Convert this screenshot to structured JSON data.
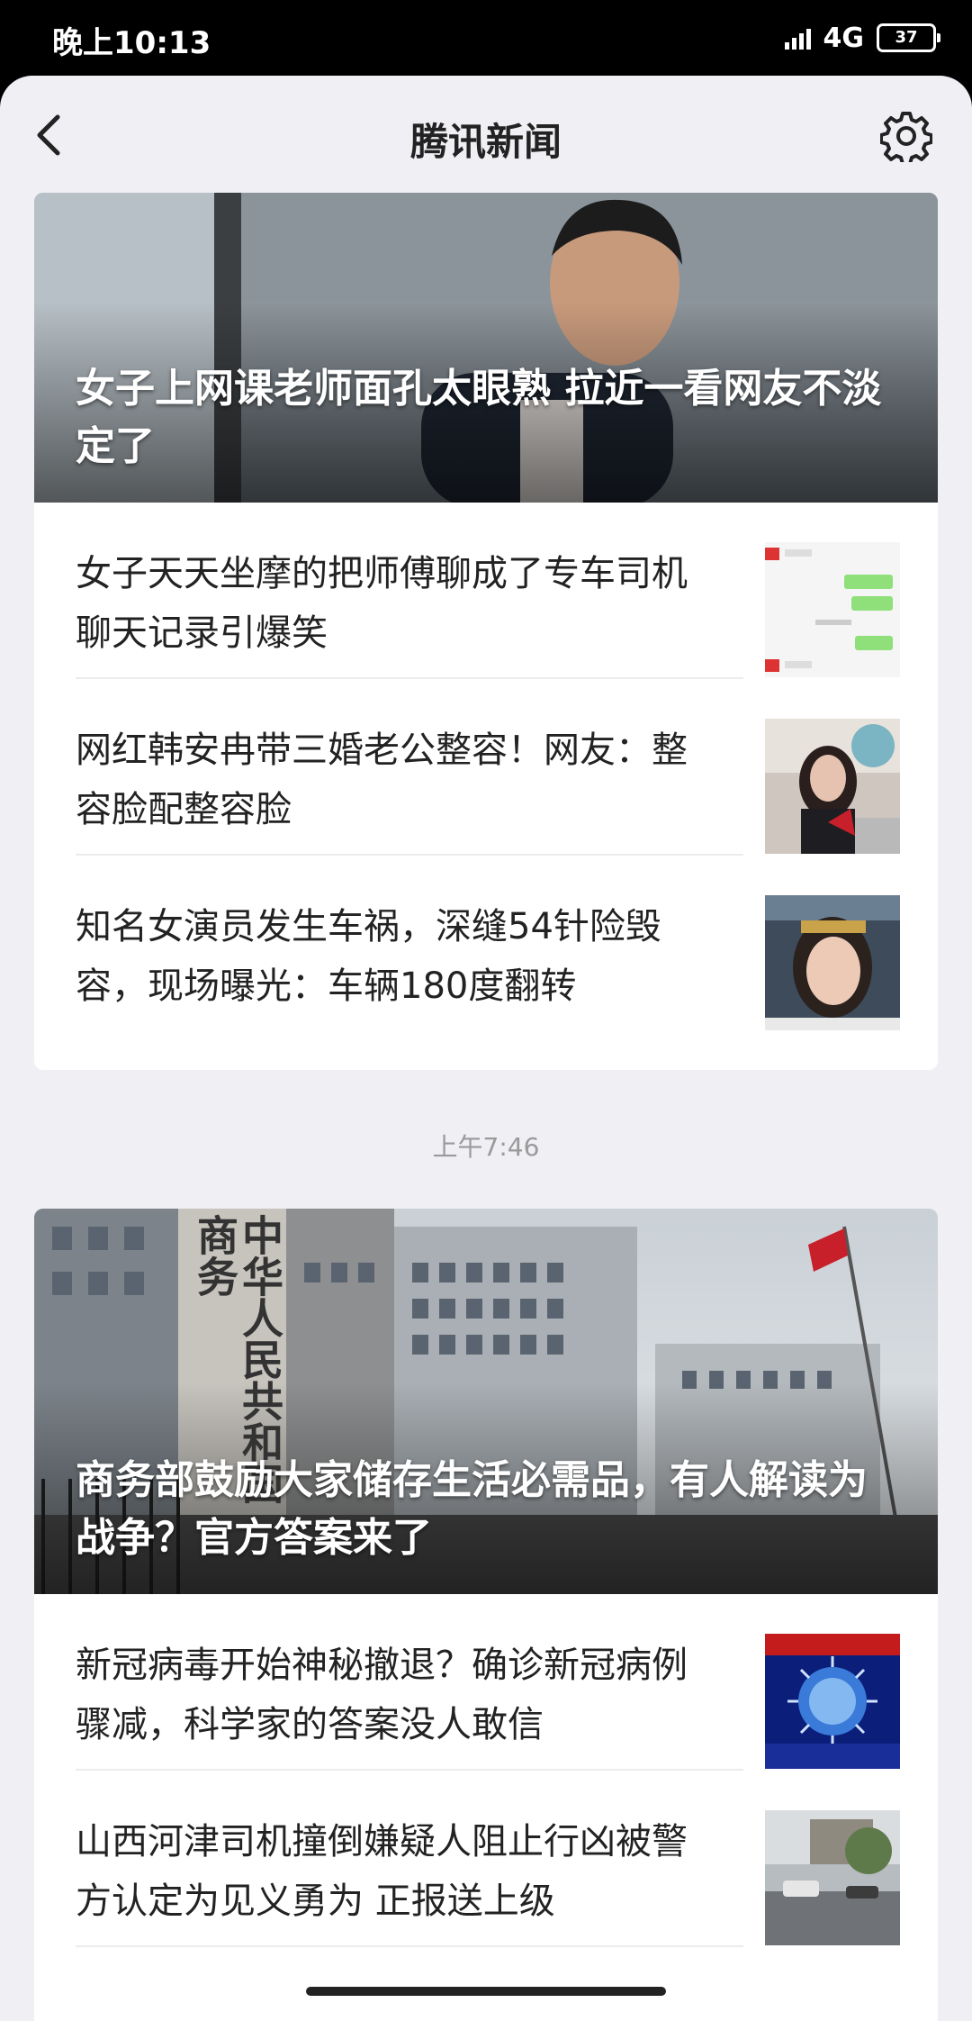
{
  "status_bar": {
    "time": "晚上10:13",
    "network": "4G",
    "battery": "37"
  },
  "nav": {
    "title": "腾讯新闻",
    "back_icon": "chevron-left-icon",
    "settings_icon": "gear-icon"
  },
  "group1": {
    "hero_title": "女子上网课老师面孔太眼熟 拉近一看网友不淡定了",
    "items": [
      {
        "title": "女子天天坐摩的把师傅聊成了专车司机 聊天记录引爆笑"
      },
      {
        "title": "网红韩安冉带三婚老公整容！网友：整容脸配整容脸"
      },
      {
        "title": "知名女演员发生车祸，深缝54针险毁容，现场曝光：车辆180度翻转"
      }
    ]
  },
  "timestamp": "上午7:46",
  "group2": {
    "hero_title": "商务部鼓励大家储存生活必需品，有人解读为战争？官方答案来了",
    "hero_sign": "中华人民共和国商务",
    "items": [
      {
        "title": "新冠病毒开始神秘撤退？确诊新冠病例骤减，科学家的答案没人敢信"
      },
      {
        "title": "山西河津司机撞倒嫌疑人阻止行凶被警方认定为见义勇为 正报送上级"
      }
    ]
  }
}
